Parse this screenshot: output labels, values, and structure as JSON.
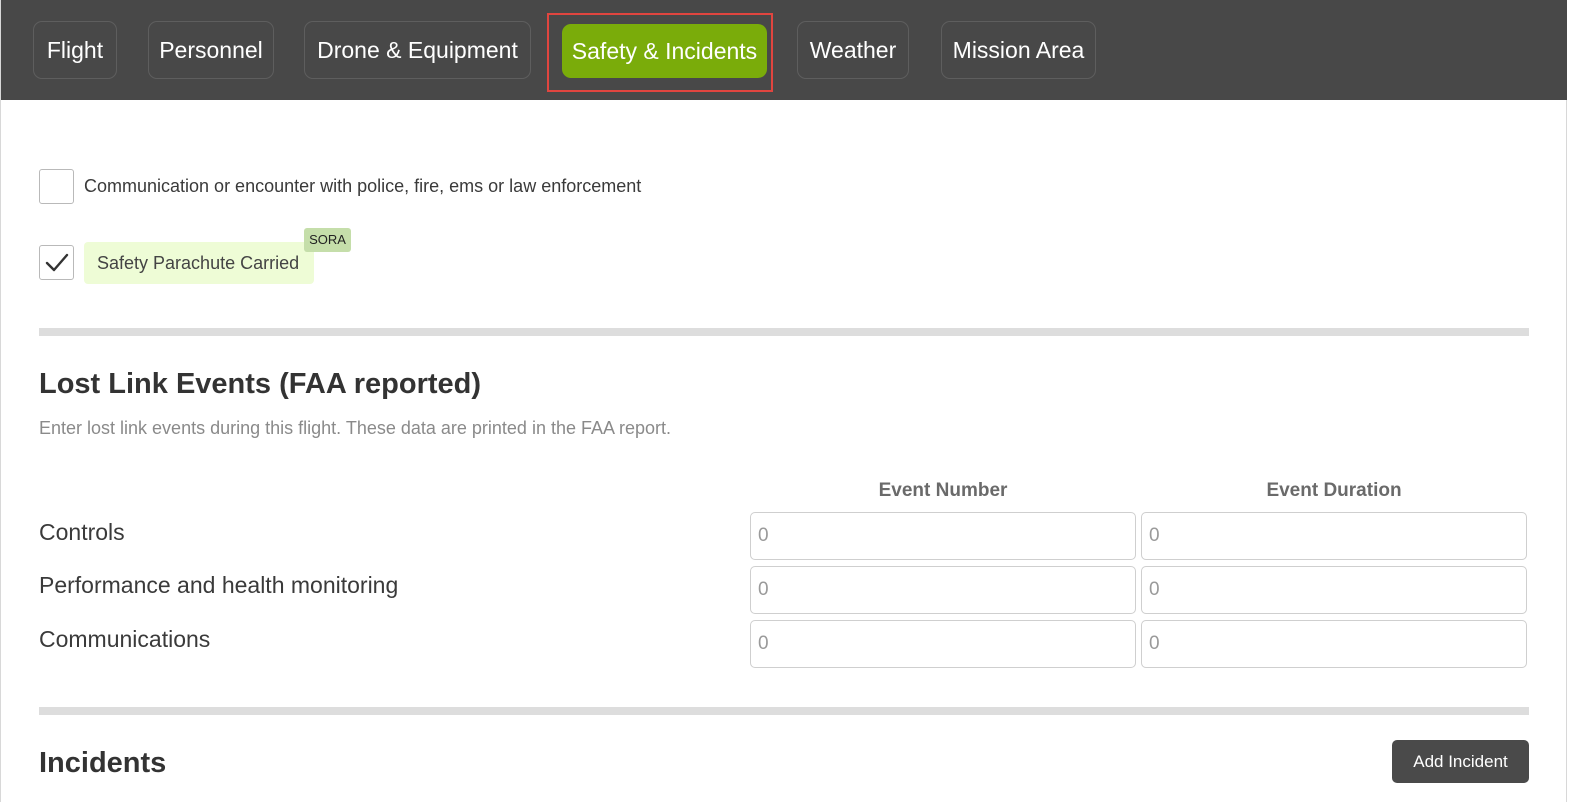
{
  "tabs": [
    {
      "label": "Flight"
    },
    {
      "label": "Personnel"
    },
    {
      "label": "Drone & Equipment"
    },
    {
      "label": "Safety & Incidents",
      "active": true
    },
    {
      "label": "Weather"
    },
    {
      "label": "Mission Area"
    }
  ],
  "checkboxes": {
    "police": {
      "label": "Communication or encounter with police, fire, ems or law enforcement",
      "checked": false
    },
    "parachute": {
      "label": "Safety Parachute Carried",
      "checked": true,
      "badge": "SORA"
    }
  },
  "lost_link": {
    "title": "Lost Link Events (FAA reported)",
    "description": "Enter lost link events during this flight. These data are printed in the FAA report.",
    "columns": [
      "Event Number",
      "Event Duration"
    ],
    "rows": [
      {
        "label": "Controls",
        "event_number_placeholder": "0",
        "event_duration_placeholder": "0"
      },
      {
        "label": "Performance and health monitoring",
        "event_number_placeholder": "0",
        "event_duration_placeholder": "0"
      },
      {
        "label": "Communications",
        "event_number_placeholder": "0",
        "event_duration_placeholder": "0"
      }
    ]
  },
  "incidents": {
    "title": "Incidents",
    "add_button": "Add Incident"
  },
  "colors": {
    "tabbar_bg": "#484848",
    "active_tab": "#7aac0a",
    "highlight_outline": "#e0453f",
    "sora_label_bg": "#eefcd6",
    "sora_badge_bg": "#c5deaa",
    "button_bg": "#4a4a4a"
  }
}
